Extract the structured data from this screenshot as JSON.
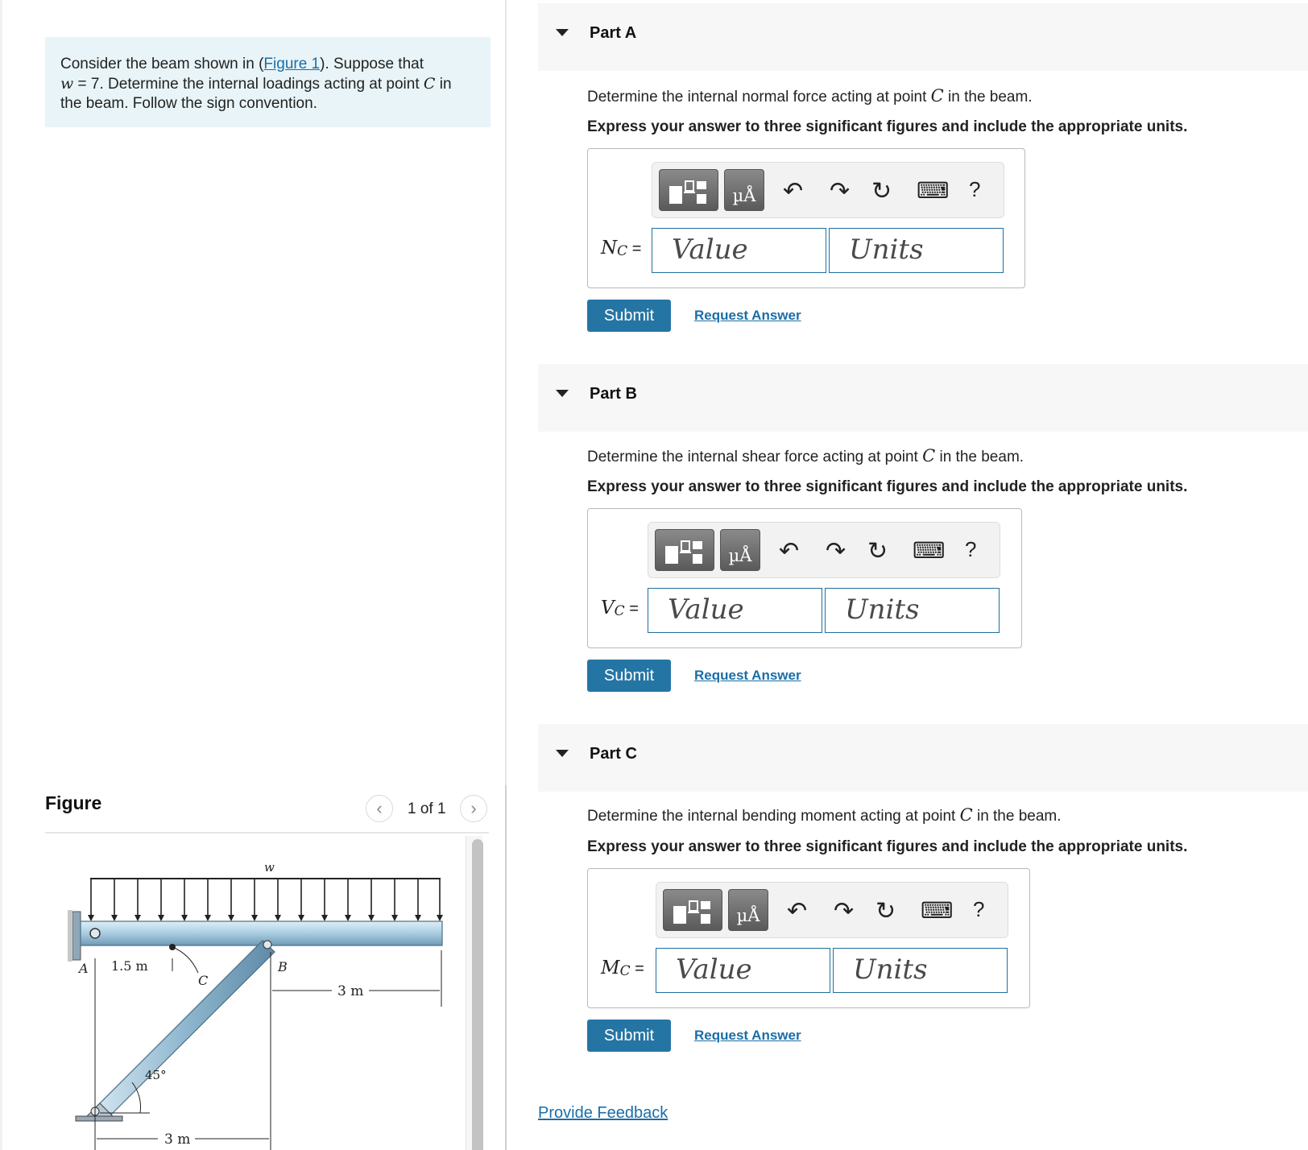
{
  "problem": {
    "text_before_link": "Consider the beam shown in (",
    "link": "Figure 1",
    "text_after_link": "). Suppose that",
    "w_var": "w",
    "w_eq": " = 7. Determine the internal loadings acting at point ",
    "c_var": "C",
    "text_end": " in the beam. Follow the sign convention."
  },
  "figure": {
    "title": "Figure",
    "pager": "1 of 1",
    "labels": {
      "w": "w",
      "a": "A",
      "b": "B",
      "c": "C",
      "dim_15": "1.5 m",
      "dim_3_top": "3 m",
      "dim_3_bottom": "3 m",
      "angle": "45°"
    }
  },
  "parts": [
    {
      "title": "Part A",
      "q_before": "Determine the internal normal force acting at point ",
      "q_var": "C",
      "q_after": " in the beam.",
      "instruction": "Express your answer to three significant figures and include the appropriate units.",
      "var_letter": "N",
      "var_sub": "C",
      "eq": " =",
      "value_placeholder": "Value",
      "units_placeholder": "Units",
      "submit": "Submit",
      "request": "Request Answer"
    },
    {
      "title": "Part B",
      "q_before": "Determine the internal shear force acting at point ",
      "q_var": "C",
      "q_after": " in the beam.",
      "instruction": "Express your answer to three significant figures and include the appropriate units.",
      "var_letter": "V",
      "var_sub": "C",
      "eq": " =",
      "value_placeholder": "Value",
      "units_placeholder": "Units",
      "submit": "Submit",
      "request": "Request Answer"
    },
    {
      "title": "Part C",
      "q_before": "Determine the internal bending moment acting at point ",
      "q_var": "C",
      "q_after": " in the beam.",
      "instruction": "Express your answer to three significant figures and include the appropriate units.",
      "var_letter": "M",
      "var_sub": "C",
      "eq": " =",
      "value_placeholder": "Value",
      "units_placeholder": "Units",
      "submit": "Submit",
      "request": "Request Answer"
    }
  ],
  "toolbar": {
    "units_btn": "µÅ",
    "undo": "↶",
    "redo": "↷",
    "reset": "↻",
    "keyboard": "⌨",
    "help": "?"
  },
  "feedback": "Provide Feedback",
  "colors": {
    "accent": "#2575a4",
    "link": "#1a6ea8",
    "problem_bg": "#e8f4f7"
  }
}
